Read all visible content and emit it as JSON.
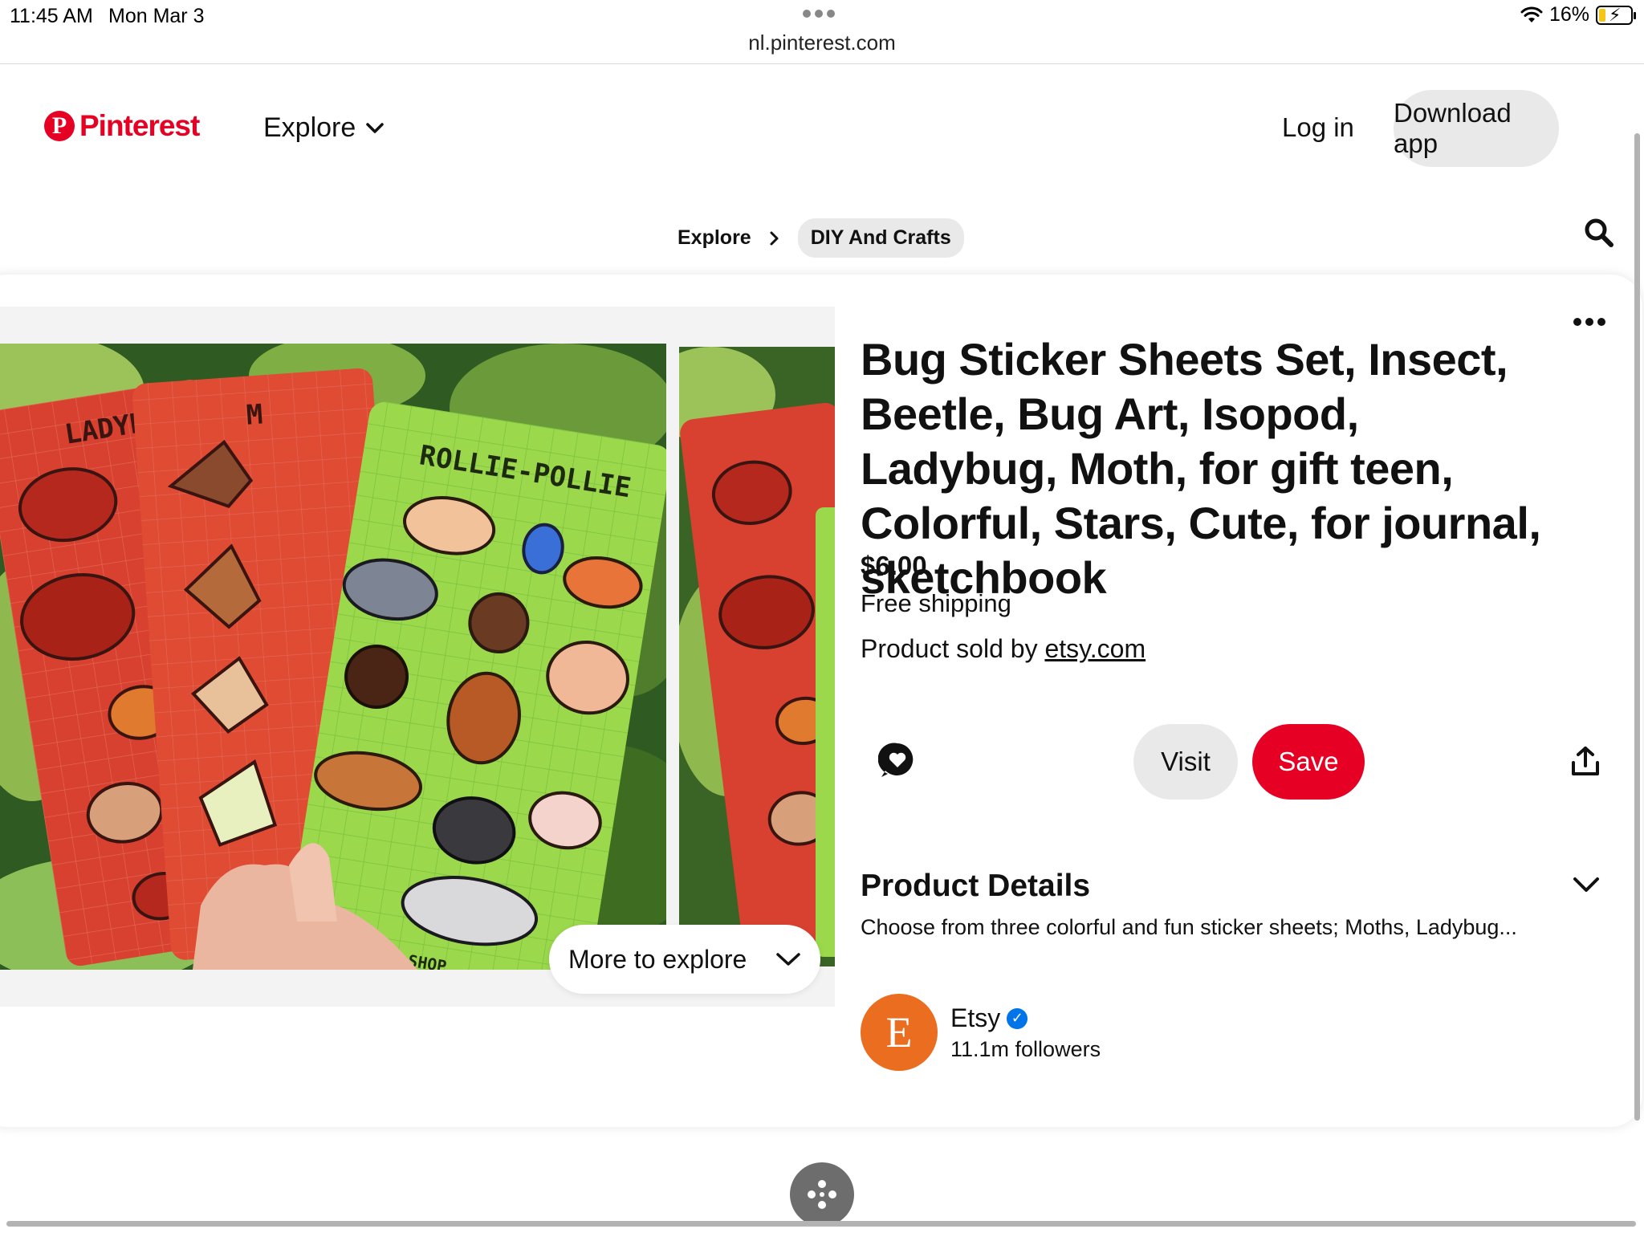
{
  "status_bar": {
    "time": "11:45 AM",
    "date": "Mon Mar 3",
    "url": "nl.pinterest.com",
    "battery": "16%"
  },
  "header": {
    "brand": "Pinterest",
    "brand_color": "#e60023",
    "explore": "Explore",
    "login": "Log in",
    "download": "Download app"
  },
  "breadcrumb": {
    "root": "Explore",
    "current": "DIY And Crafts"
  },
  "image_texts": {
    "card1": "LADYB",
    "card2": "M",
    "card3": "ROLLIE-POLLIE",
    "signature": "AEZQUE SHOP"
  },
  "more_to_explore": "More to explore",
  "pin": {
    "title": "Bug Sticker Sheets Set, Insect, Beetle, Bug Art, Isopod, Ladybug, Moth, for gift teen, Colorful, Stars, Cute, for journal, sketchbook",
    "price": "$6.00",
    "shipping": "Free shipping",
    "sold_by_prefix": "Product sold by",
    "sold_by_link": "etsy.com",
    "visit": "Visit",
    "save": "Save",
    "product_details_title": "Product Details",
    "product_details_desc": "Choose from three colorful and fun sticker sheets; Moths, Ladybug..."
  },
  "creator": {
    "initial": "E",
    "name": "Etsy",
    "followers": "11.1m followers",
    "avatar_color": "#eb6d20"
  },
  "icons": [
    "wifi-icon",
    "battery-icon",
    "pinterest-logo-icon",
    "chevron-down-icon",
    "chevron-right-icon",
    "search-icon",
    "more-icon",
    "comment-icon",
    "share-icon",
    "verified-icon",
    "gestures-icon"
  ]
}
